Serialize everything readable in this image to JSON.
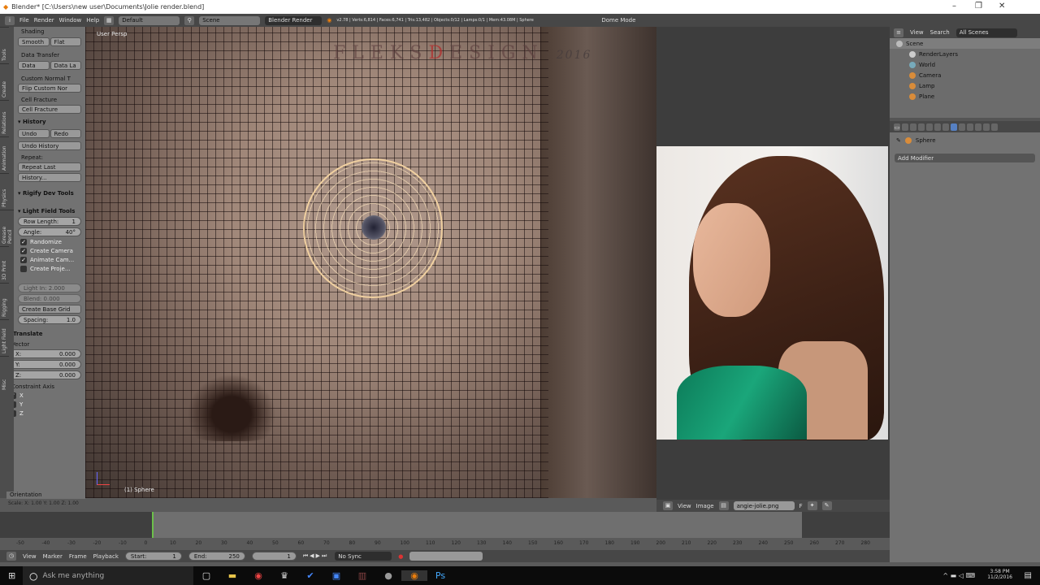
{
  "window": {
    "title": "Blender* [C:\\Users\\new user\\Documents\\Jolie render.blend]",
    "minimize": "–",
    "restore": "❐",
    "close": "✕"
  },
  "topbar": {
    "menus": [
      "File",
      "Render",
      "Window",
      "Help"
    ],
    "layout": "Default",
    "scene": "Scene",
    "engine": "Blender Render",
    "stats": "v2.78 | Verts:6,814 | Faces:6,741 | Tris:13,482 | Objects:0/12 | Lamps:0/1 | Mem:43.08M | Sphere",
    "mode": "Dome Mode"
  },
  "toolpanel": {
    "tabs": [
      "Tools",
      "Create",
      "Relations",
      "Animation",
      "Physics",
      "Grease Pencil",
      "3D Print",
      "Rigging",
      "Light Field",
      "Misc"
    ],
    "shading_label": "Shading",
    "smooth": "Smooth",
    "flat": "Flat",
    "data_transfer": "Data Transfer",
    "data": "Data",
    "data_layout": "Data La",
    "custom_normal": "Custom Normal T",
    "flip_custom": "Flip Custom Nor",
    "cell_fracture_label": "Cell Fracture",
    "cell_fracture": "Cell Fracture",
    "history": "History",
    "undo": "Undo",
    "redo": "Redo",
    "undo_history": "Undo History",
    "repeat_label": "Repeat:",
    "repeat_last": "Repeat Last",
    "history_btn": "History...",
    "rigify": "Rigify Dev Tools",
    "light_field": "Light Field Tools",
    "row_length_label": "Row Length:",
    "row_length": "1",
    "angle_label": "Angle:",
    "angle": "40°",
    "checks": [
      {
        "label": "Randomize",
        "checked": true
      },
      {
        "label": "Create Camera",
        "checked": true
      },
      {
        "label": "Animate Cam...",
        "checked": true
      },
      {
        "label": "Create Proje...",
        "checked": false
      }
    ],
    "light_in": "Light In: 2.000",
    "blend": "Blend: 0.000",
    "create_base_grid": "Create Base Grid",
    "spacing_label": "Spacing:",
    "spacing": "1.0",
    "operator": "Translate",
    "vector_label": "Vector",
    "x_label": "X:",
    "x": "0.000",
    "y_label": "Y:",
    "y": "0.000",
    "z_label": "Z:",
    "z": "0.000",
    "constraint_label": "Constraint Axis",
    "axes": [
      "X",
      "Y",
      "Z"
    ],
    "orientation_label": "Orientation",
    "status": "Scale: X: 1.00 Y: 1.00 Z: 1.00"
  },
  "viewport": {
    "view_label": "User Persp",
    "object_label": "(1) Sphere",
    "watermark_a": "FLEKS",
    "watermark_b": "D",
    "watermark_c": "ESIGN",
    "watermark_year": "2016"
  },
  "image_editor": {
    "view": "View",
    "image": "Image",
    "filename": "angie-jolie.png",
    "flag": "F"
  },
  "outliner": {
    "view": "View",
    "search": "Search",
    "scenes": "All Scenes",
    "items": [
      "Scene",
      "RenderLayers",
      "World",
      "Camera",
      "Lamp",
      "Plane"
    ]
  },
  "properties": {
    "object": "Sphere",
    "add_modifier": "Add Modifier"
  },
  "timeline": {
    "ticks": [
      "-50",
      "-40",
      "-30",
      "-20",
      "-10",
      "0",
      "10",
      "20",
      "30",
      "40",
      "50",
      "60",
      "70",
      "80",
      "90",
      "100",
      "110",
      "120",
      "130",
      "140",
      "150",
      "160",
      "170",
      "180",
      "190",
      "200",
      "210",
      "220",
      "230",
      "240",
      "250",
      "260",
      "270",
      "280"
    ],
    "view": "View",
    "marker": "Marker",
    "frame": "Frame",
    "playback": "Playback",
    "start_label": "Start:",
    "start": "1",
    "end_label": "End:",
    "end": "250",
    "current": "1",
    "sync": "No Sync"
  },
  "taskbar": {
    "search": "Ask me anything",
    "time": "3:58 PM",
    "date": "11/2/2016"
  }
}
